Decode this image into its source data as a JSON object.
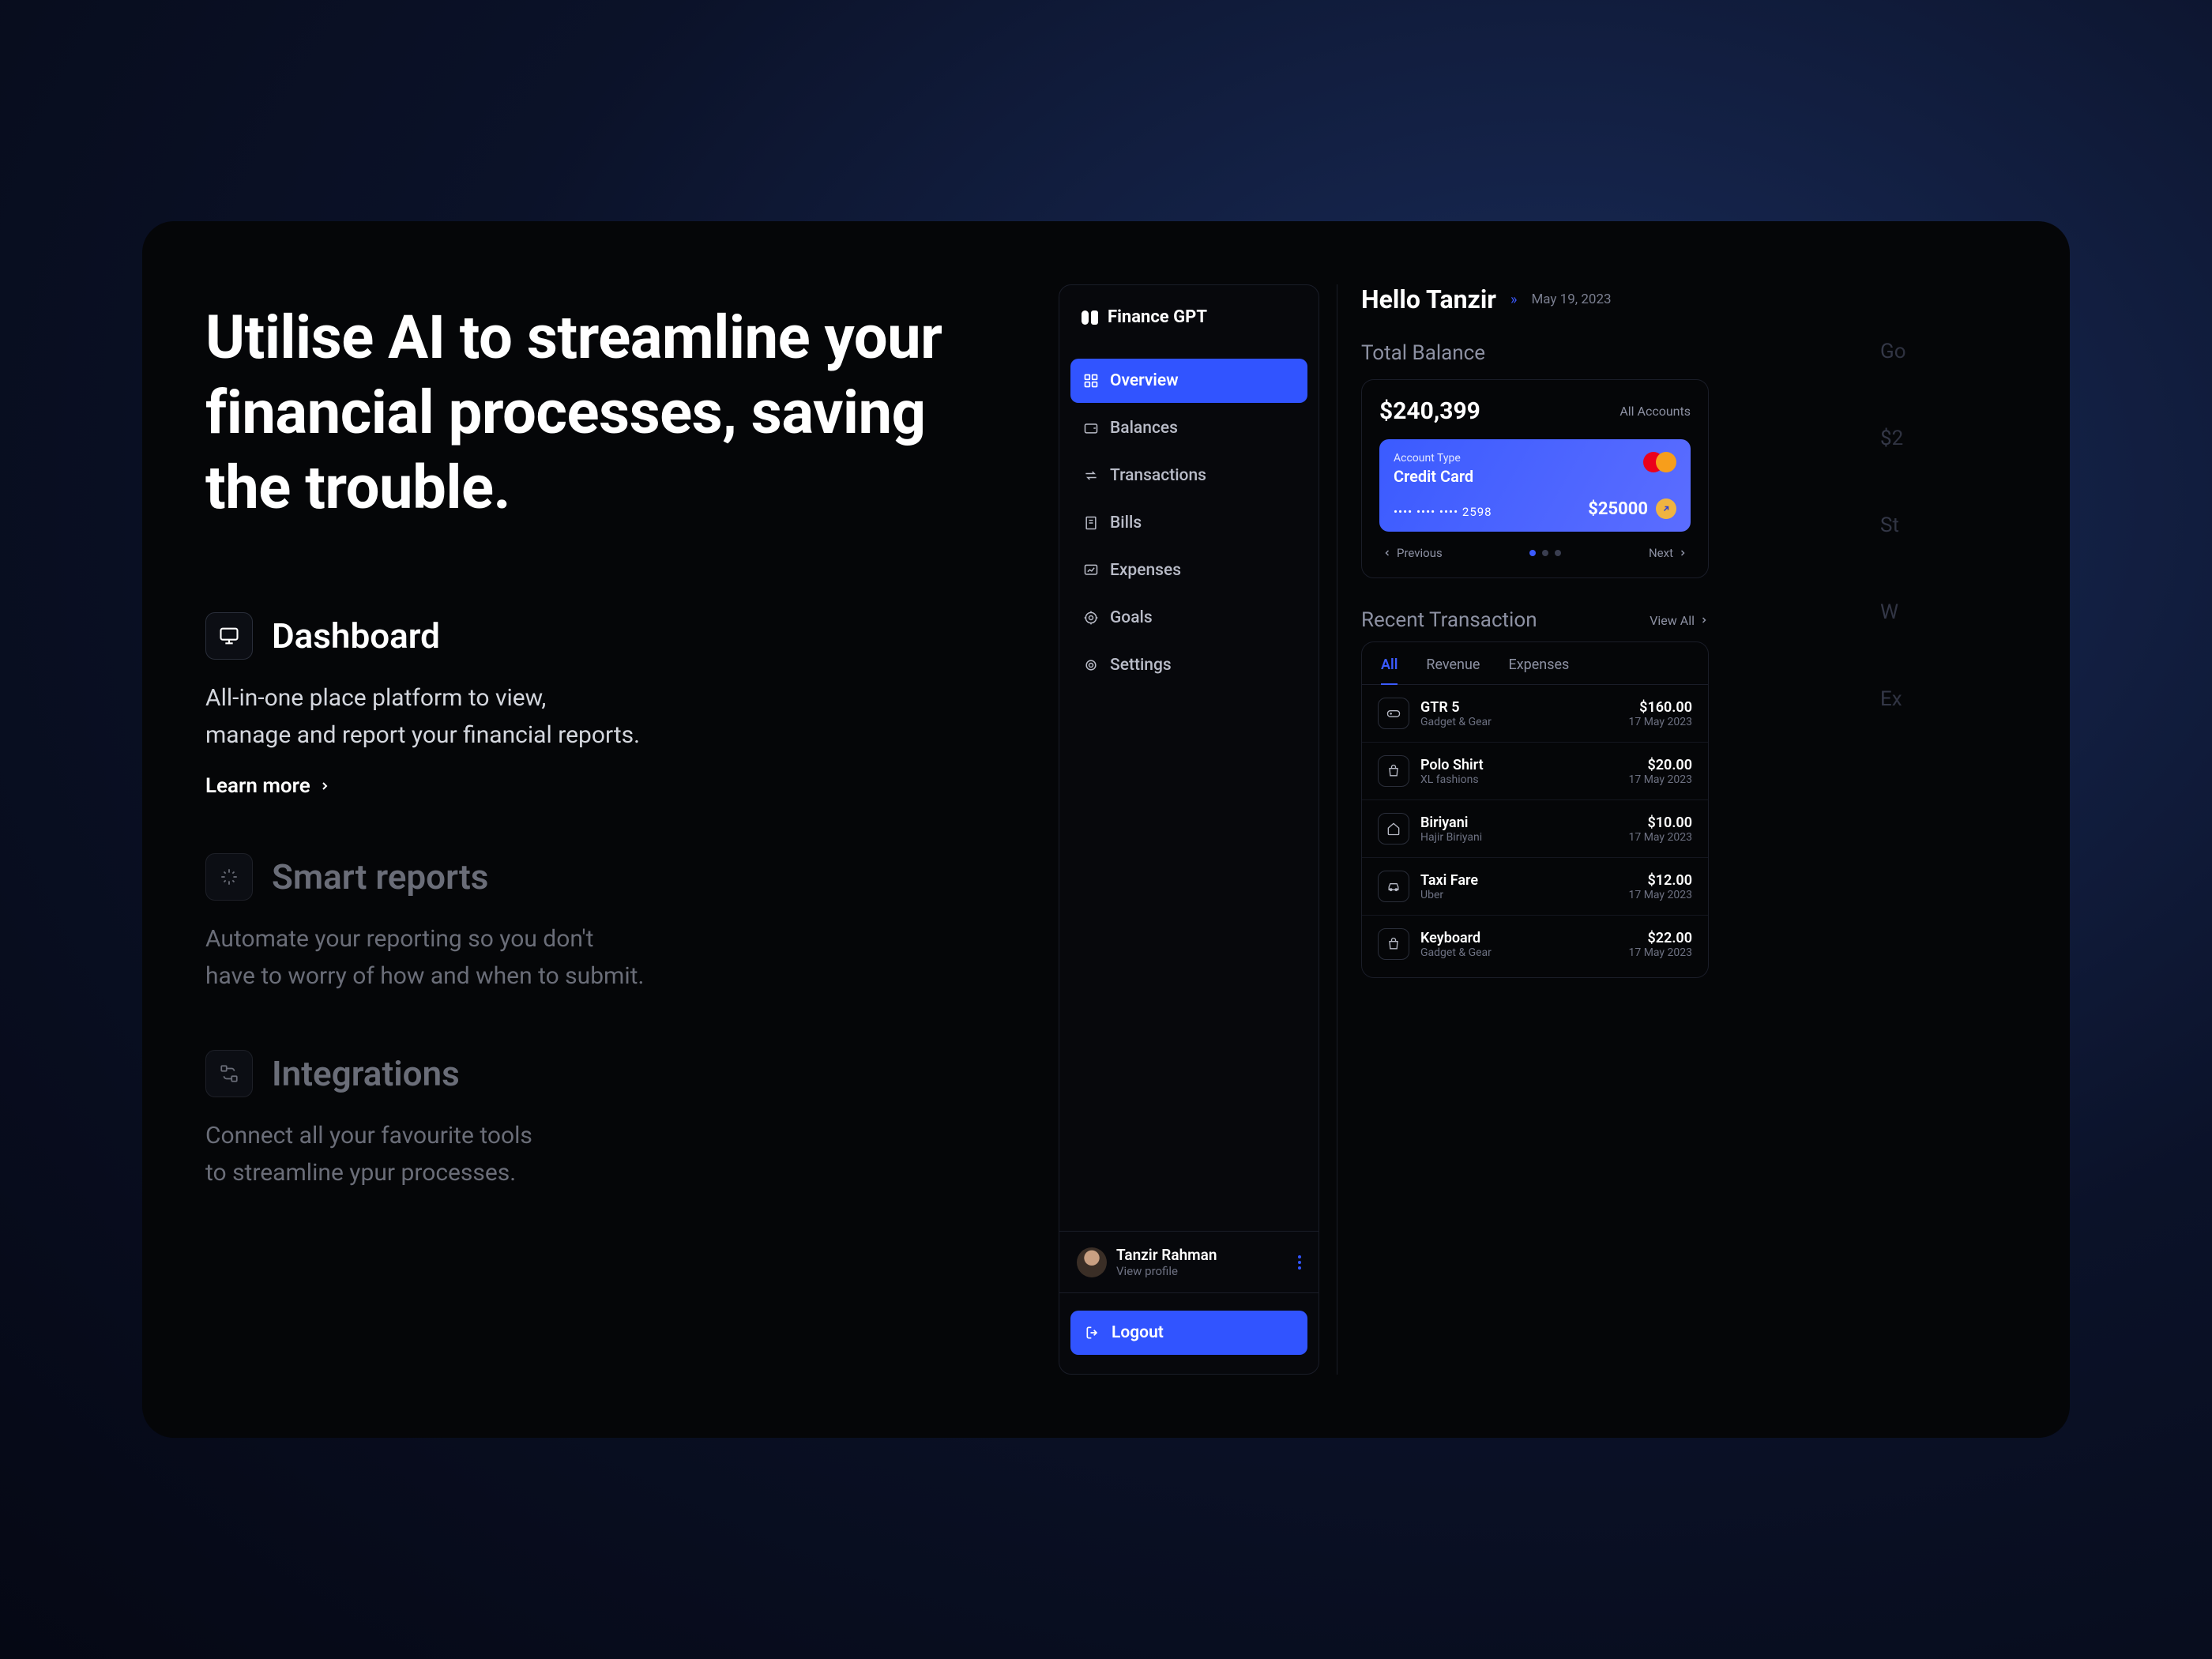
{
  "headline": "Utilise AI to streamline your financial processes, saving the trouble.",
  "features": [
    {
      "title": "Dashboard",
      "desc_l1": "All-in-one place platform to view,",
      "desc_l2": "manage and report your financial reports.",
      "learn": "Learn more"
    },
    {
      "title": "Smart reports",
      "desc_l1": "Automate your reporting so you don't",
      "desc_l2": "have to worry of how and when to submit."
    },
    {
      "title": "Integrations",
      "desc_l1": "Connect all your favourite tools",
      "desc_l2": "to streamline ypur processes."
    }
  ],
  "app": {
    "brand": "Finance GPT",
    "nav": {
      "overview": "Overview",
      "balances": "Balances",
      "transactions": "Transactions",
      "bills": "Bills",
      "expenses": "Expenses",
      "goals": "Goals",
      "settings": "Settings"
    },
    "profile": {
      "name": "Tanzir Rahman",
      "sub": "View profile"
    },
    "logout": "Logout",
    "greeting": "Hello Tanzir",
    "date": "May 19, 2023",
    "balance": {
      "label": "Total Balance",
      "amount": "$240,399",
      "accounts_label": "All Accounts",
      "card": {
        "type_label": "Account Type",
        "type": "Credit Card",
        "number": "•••• •••• •••• 2598",
        "balance": "$25000"
      },
      "prev": "Previous",
      "next": "Next"
    },
    "recent": {
      "label": "Recent Transaction",
      "view_all": "View All",
      "tabs": {
        "all": "All",
        "revenue": "Revenue",
        "expenses": "Expenses"
      },
      "items": [
        {
          "name": "GTR 5",
          "sub": "Gadget & Gear",
          "amount": "$160.00",
          "date": "17 May 2023"
        },
        {
          "name": "Polo Shirt",
          "sub": "XL fashions",
          "amount": "$20.00",
          "date": "17 May 2023"
        },
        {
          "name": "Biriyani",
          "sub": "Hajir Biriyani",
          "amount": "$10.00",
          "date": "17 May 2023"
        },
        {
          "name": "Taxi Fare",
          "sub": "Uber",
          "amount": "$12.00",
          "date": "17 May 2023"
        },
        {
          "name": "Keyboard",
          "sub": "Gadget & Gear",
          "amount": "$22.00",
          "date": "17 May 2023"
        }
      ]
    },
    "ghost": {
      "g1": "Go",
      "g2": "$2",
      "g3": "St",
      "g4": "W",
      "g5": "Ex"
    }
  },
  "colors": {
    "accent": "#3154ff"
  }
}
